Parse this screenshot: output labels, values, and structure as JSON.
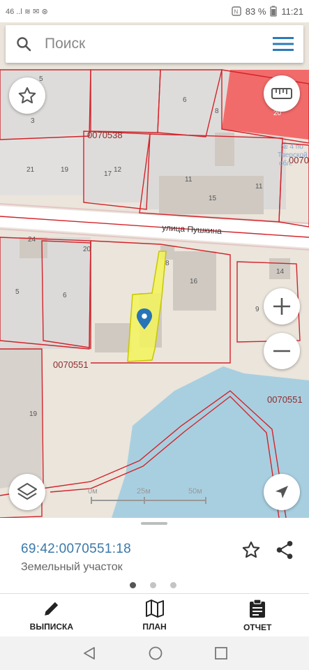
{
  "status_bar": {
    "left_text": "46 ..l  ≋  ✉  ⊛",
    "battery": "83 %",
    "time": "11:21"
  },
  "search": {
    "placeholder": "Поиск"
  },
  "map": {
    "street_name": "улица Пушкина",
    "quarter_labels": [
      "0070538",
      "0070551",
      "0070551",
      "0070"
    ],
    "building_numbers": [
      "5",
      "3",
      "6",
      "8",
      "21",
      "19",
      "17",
      "12",
      "11",
      "11",
      "15",
      "24",
      "20",
      "5",
      "6",
      "8",
      "16",
      "14",
      "9",
      "19",
      "20"
    ],
    "faded_text": [
      "№ 4 по",
      "Тверской",
      "обл."
    ],
    "scale": {
      "labels": [
        "0м",
        "25м",
        "50м"
      ]
    },
    "parcel_color": "#f5f55a",
    "water_color": "#a8cfe0",
    "boundary_color": "#d2232a"
  },
  "parcel": {
    "cadastral_number": "69:42:0070551:18",
    "type": "Земельный участок",
    "page_indicator": {
      "count": 3,
      "active": 0
    }
  },
  "tabs": [
    {
      "label": "ВЫПИСКА",
      "icon": "pencil-icon"
    },
    {
      "label": "ПЛАН",
      "icon": "map-icon"
    },
    {
      "label": "ОТЧЕТ",
      "icon": "clipboard-icon"
    }
  ],
  "system_nav": [
    "back-icon",
    "home-icon",
    "recents-icon"
  ]
}
